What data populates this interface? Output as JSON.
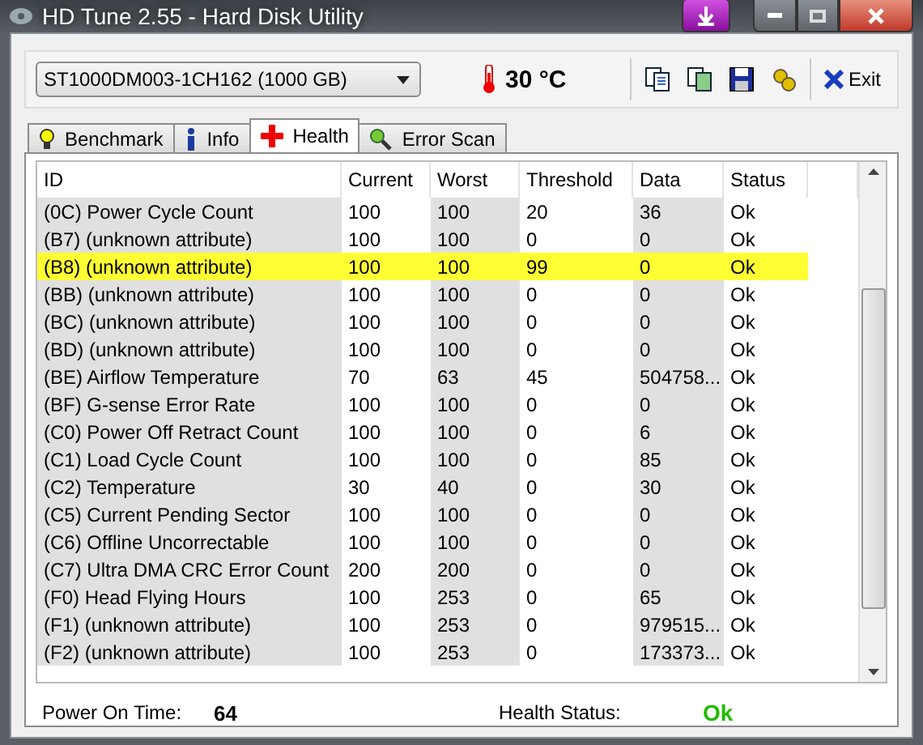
{
  "window": {
    "title": "HD Tune 2.55 - Hard Disk Utility"
  },
  "toolbar": {
    "drive": "ST1000DM003-1CH162 (1000 GB)",
    "temperature": "30 °C",
    "exit_label": "Exit"
  },
  "tabs": [
    {
      "label": "Benchmark",
      "kind": "benchmark",
      "selected": false
    },
    {
      "label": "Info",
      "kind": "info",
      "selected": false
    },
    {
      "label": "Health",
      "kind": "health",
      "selected": true
    },
    {
      "label": "Error Scan",
      "kind": "scan",
      "selected": false
    }
  ],
  "table": {
    "columns": [
      "ID",
      "Current",
      "Worst",
      "Threshold",
      "Data",
      "Status"
    ],
    "rows": [
      {
        "cells": [
          "(0C) Power Cycle Count",
          "100",
          "100",
          "20",
          "36",
          "Ok"
        ],
        "selected": false
      },
      {
        "cells": [
          "(B7) (unknown attribute)",
          "100",
          "100",
          "0",
          "0",
          "Ok"
        ],
        "selected": false
      },
      {
        "cells": [
          "(B8) (unknown attribute)",
          "100",
          "100",
          "99",
          "0",
          "Ok"
        ],
        "selected": true
      },
      {
        "cells": [
          "(BB) (unknown attribute)",
          "100",
          "100",
          "0",
          "0",
          "Ok"
        ],
        "selected": false
      },
      {
        "cells": [
          "(BC) (unknown attribute)",
          "100",
          "100",
          "0",
          "0",
          "Ok"
        ],
        "selected": false
      },
      {
        "cells": [
          "(BD) (unknown attribute)",
          "100",
          "100",
          "0",
          "0",
          "Ok"
        ],
        "selected": false
      },
      {
        "cells": [
          "(BE) Airflow Temperature",
          "70",
          "63",
          "45",
          "504758...",
          "Ok"
        ],
        "selected": false
      },
      {
        "cells": [
          "(BF) G-sense Error Rate",
          "100",
          "100",
          "0",
          "0",
          "Ok"
        ],
        "selected": false
      },
      {
        "cells": [
          "(C0) Power Off Retract Count",
          "100",
          "100",
          "0",
          "6",
          "Ok"
        ],
        "selected": false
      },
      {
        "cells": [
          "(C1) Load Cycle Count",
          "100",
          "100",
          "0",
          "85",
          "Ok"
        ],
        "selected": false
      },
      {
        "cells": [
          "(C2) Temperature",
          "30",
          "40",
          "0",
          "30",
          "Ok"
        ],
        "selected": false
      },
      {
        "cells": [
          "(C5) Current Pending Sector",
          "100",
          "100",
          "0",
          "0",
          "Ok"
        ],
        "selected": false
      },
      {
        "cells": [
          "(C6) Offline Uncorrectable",
          "100",
          "100",
          "0",
          "0",
          "Ok"
        ],
        "selected": false
      },
      {
        "cells": [
          "(C7) Ultra DMA CRC Error Count",
          "200",
          "200",
          "0",
          "0",
          "Ok"
        ],
        "selected": false
      },
      {
        "cells": [
          "(F0) Head Flying Hours",
          "100",
          "253",
          "0",
          "65",
          "Ok"
        ],
        "selected": false
      },
      {
        "cells": [
          "(F1) (unknown attribute)",
          "100",
          "253",
          "0",
          "979515...",
          "Ok"
        ],
        "selected": false
      },
      {
        "cells": [
          "(F2) (unknown attribute)",
          "100",
          "253",
          "0",
          "173373...",
          "Ok"
        ],
        "selected": false
      }
    ]
  },
  "footer": {
    "power_on_label": "Power On Time:",
    "power_on_value": "64",
    "health_label": "Health Status:",
    "health_value": "Ok"
  }
}
